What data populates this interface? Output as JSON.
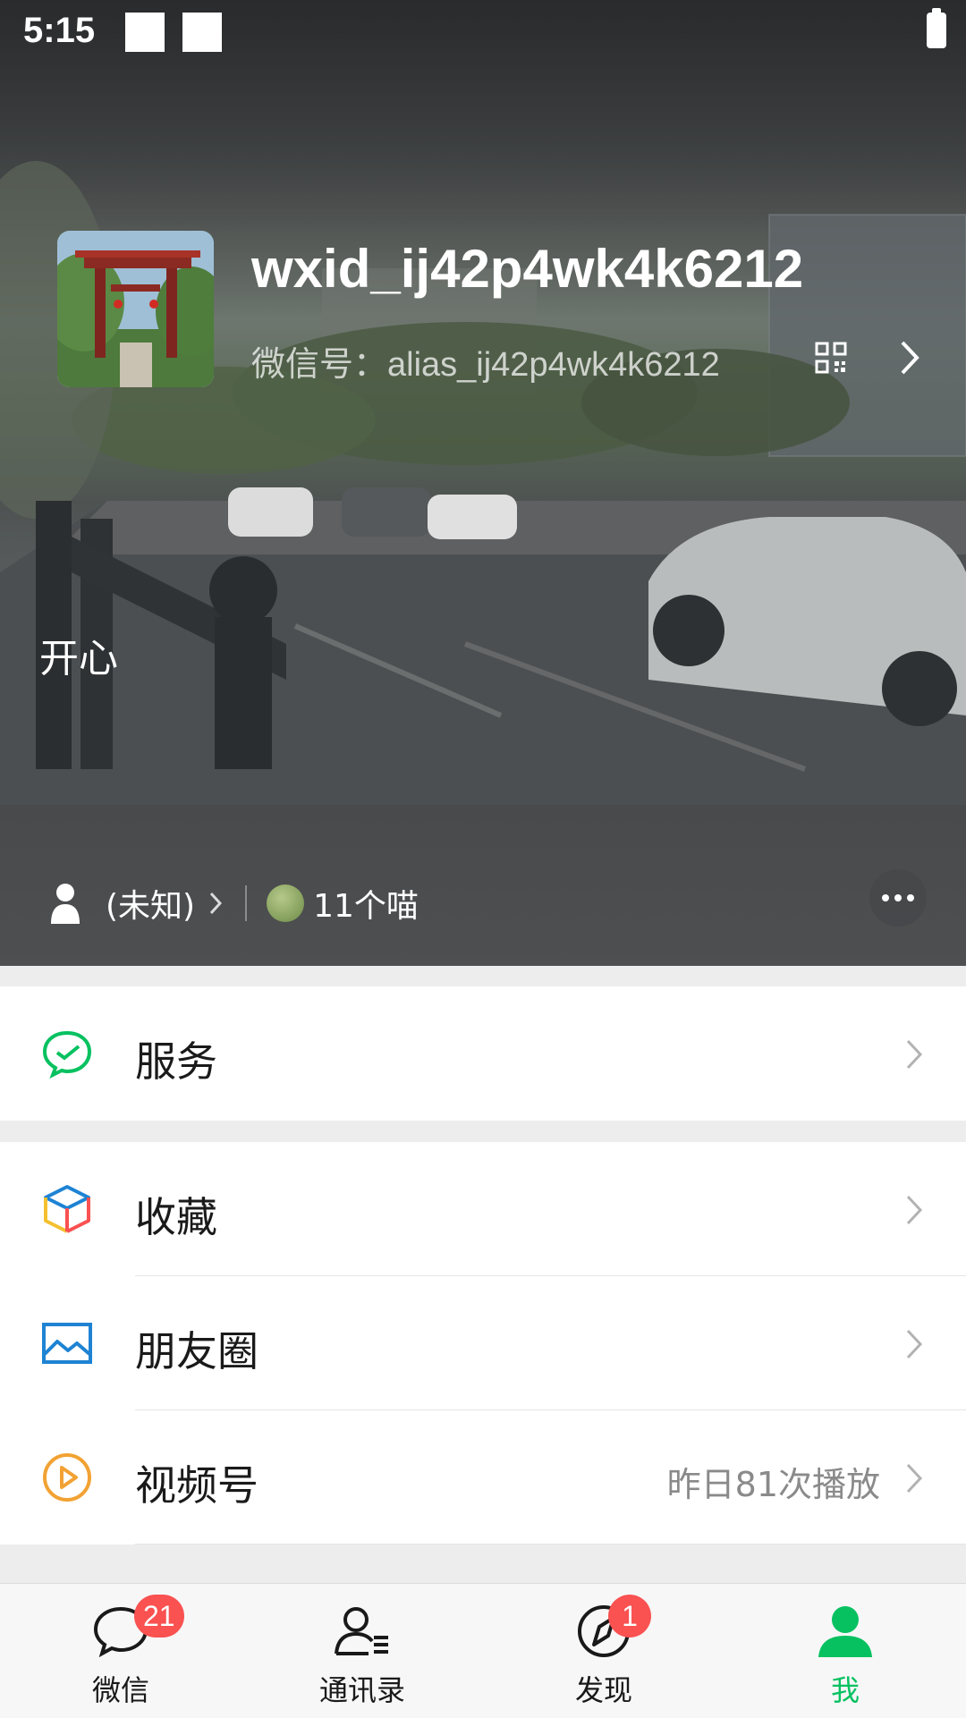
{
  "status_bar": {
    "time": "5:15"
  },
  "profile": {
    "nickname": "wxid_ij42p4wk4k6212",
    "wechat_id": "微信号：alias_ij42p4wk4k6212",
    "status": "开心",
    "gender": "(未知)",
    "friends_count": "11个喵"
  },
  "menu": {
    "service": {
      "label": "服务",
      "icon": "wechat-pay-icon",
      "color": "#07c160"
    },
    "favorites": {
      "label": "收藏",
      "icon": "cube-icon"
    },
    "moments": {
      "label": "朋友圈",
      "icon": "photo-icon",
      "color": "#1e83d3"
    },
    "channels": {
      "label": "视频号",
      "extra": "昨日81次播放",
      "icon": "play-icon",
      "color": "#f2a233"
    }
  },
  "tabs": [
    {
      "label": "微信",
      "badge": "21",
      "icon": "chat-icon"
    },
    {
      "label": "通讯录",
      "icon": "contacts-icon"
    },
    {
      "label": "发现",
      "badge": "1",
      "icon": "compass-icon"
    },
    {
      "label": "我",
      "icon": "me-icon",
      "active": true
    }
  ],
  "colors": {
    "accent": "#07c160",
    "badge": "#fa5151"
  }
}
